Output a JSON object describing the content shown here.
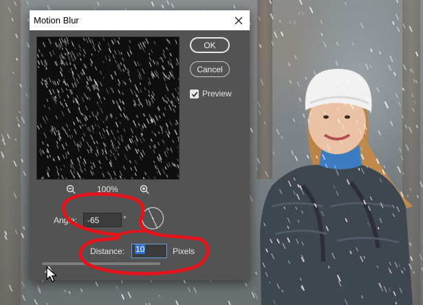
{
  "dialog": {
    "title": "Motion Blur",
    "ok_label": "OK",
    "cancel_label": "Cancel",
    "preview_label": "Preview",
    "preview_checked": true,
    "zoom_level": "100%",
    "angle_label": "Angle:",
    "angle_value": "-65",
    "angle_unit": "°",
    "distance_label": "Distance:",
    "distance_value": "10",
    "distance_unit": "Pixels",
    "distance_slider_fraction": 0.02
  },
  "icons": [
    "close-icon",
    "zoom-out-icon",
    "zoom-in-icon",
    "check-icon",
    "angle-dial-icon",
    "cursor-pointer-icon"
  ],
  "colors": {
    "dialog_bg": "#535353",
    "annotation": "#e0141a",
    "selection": "#2f6fd1"
  }
}
